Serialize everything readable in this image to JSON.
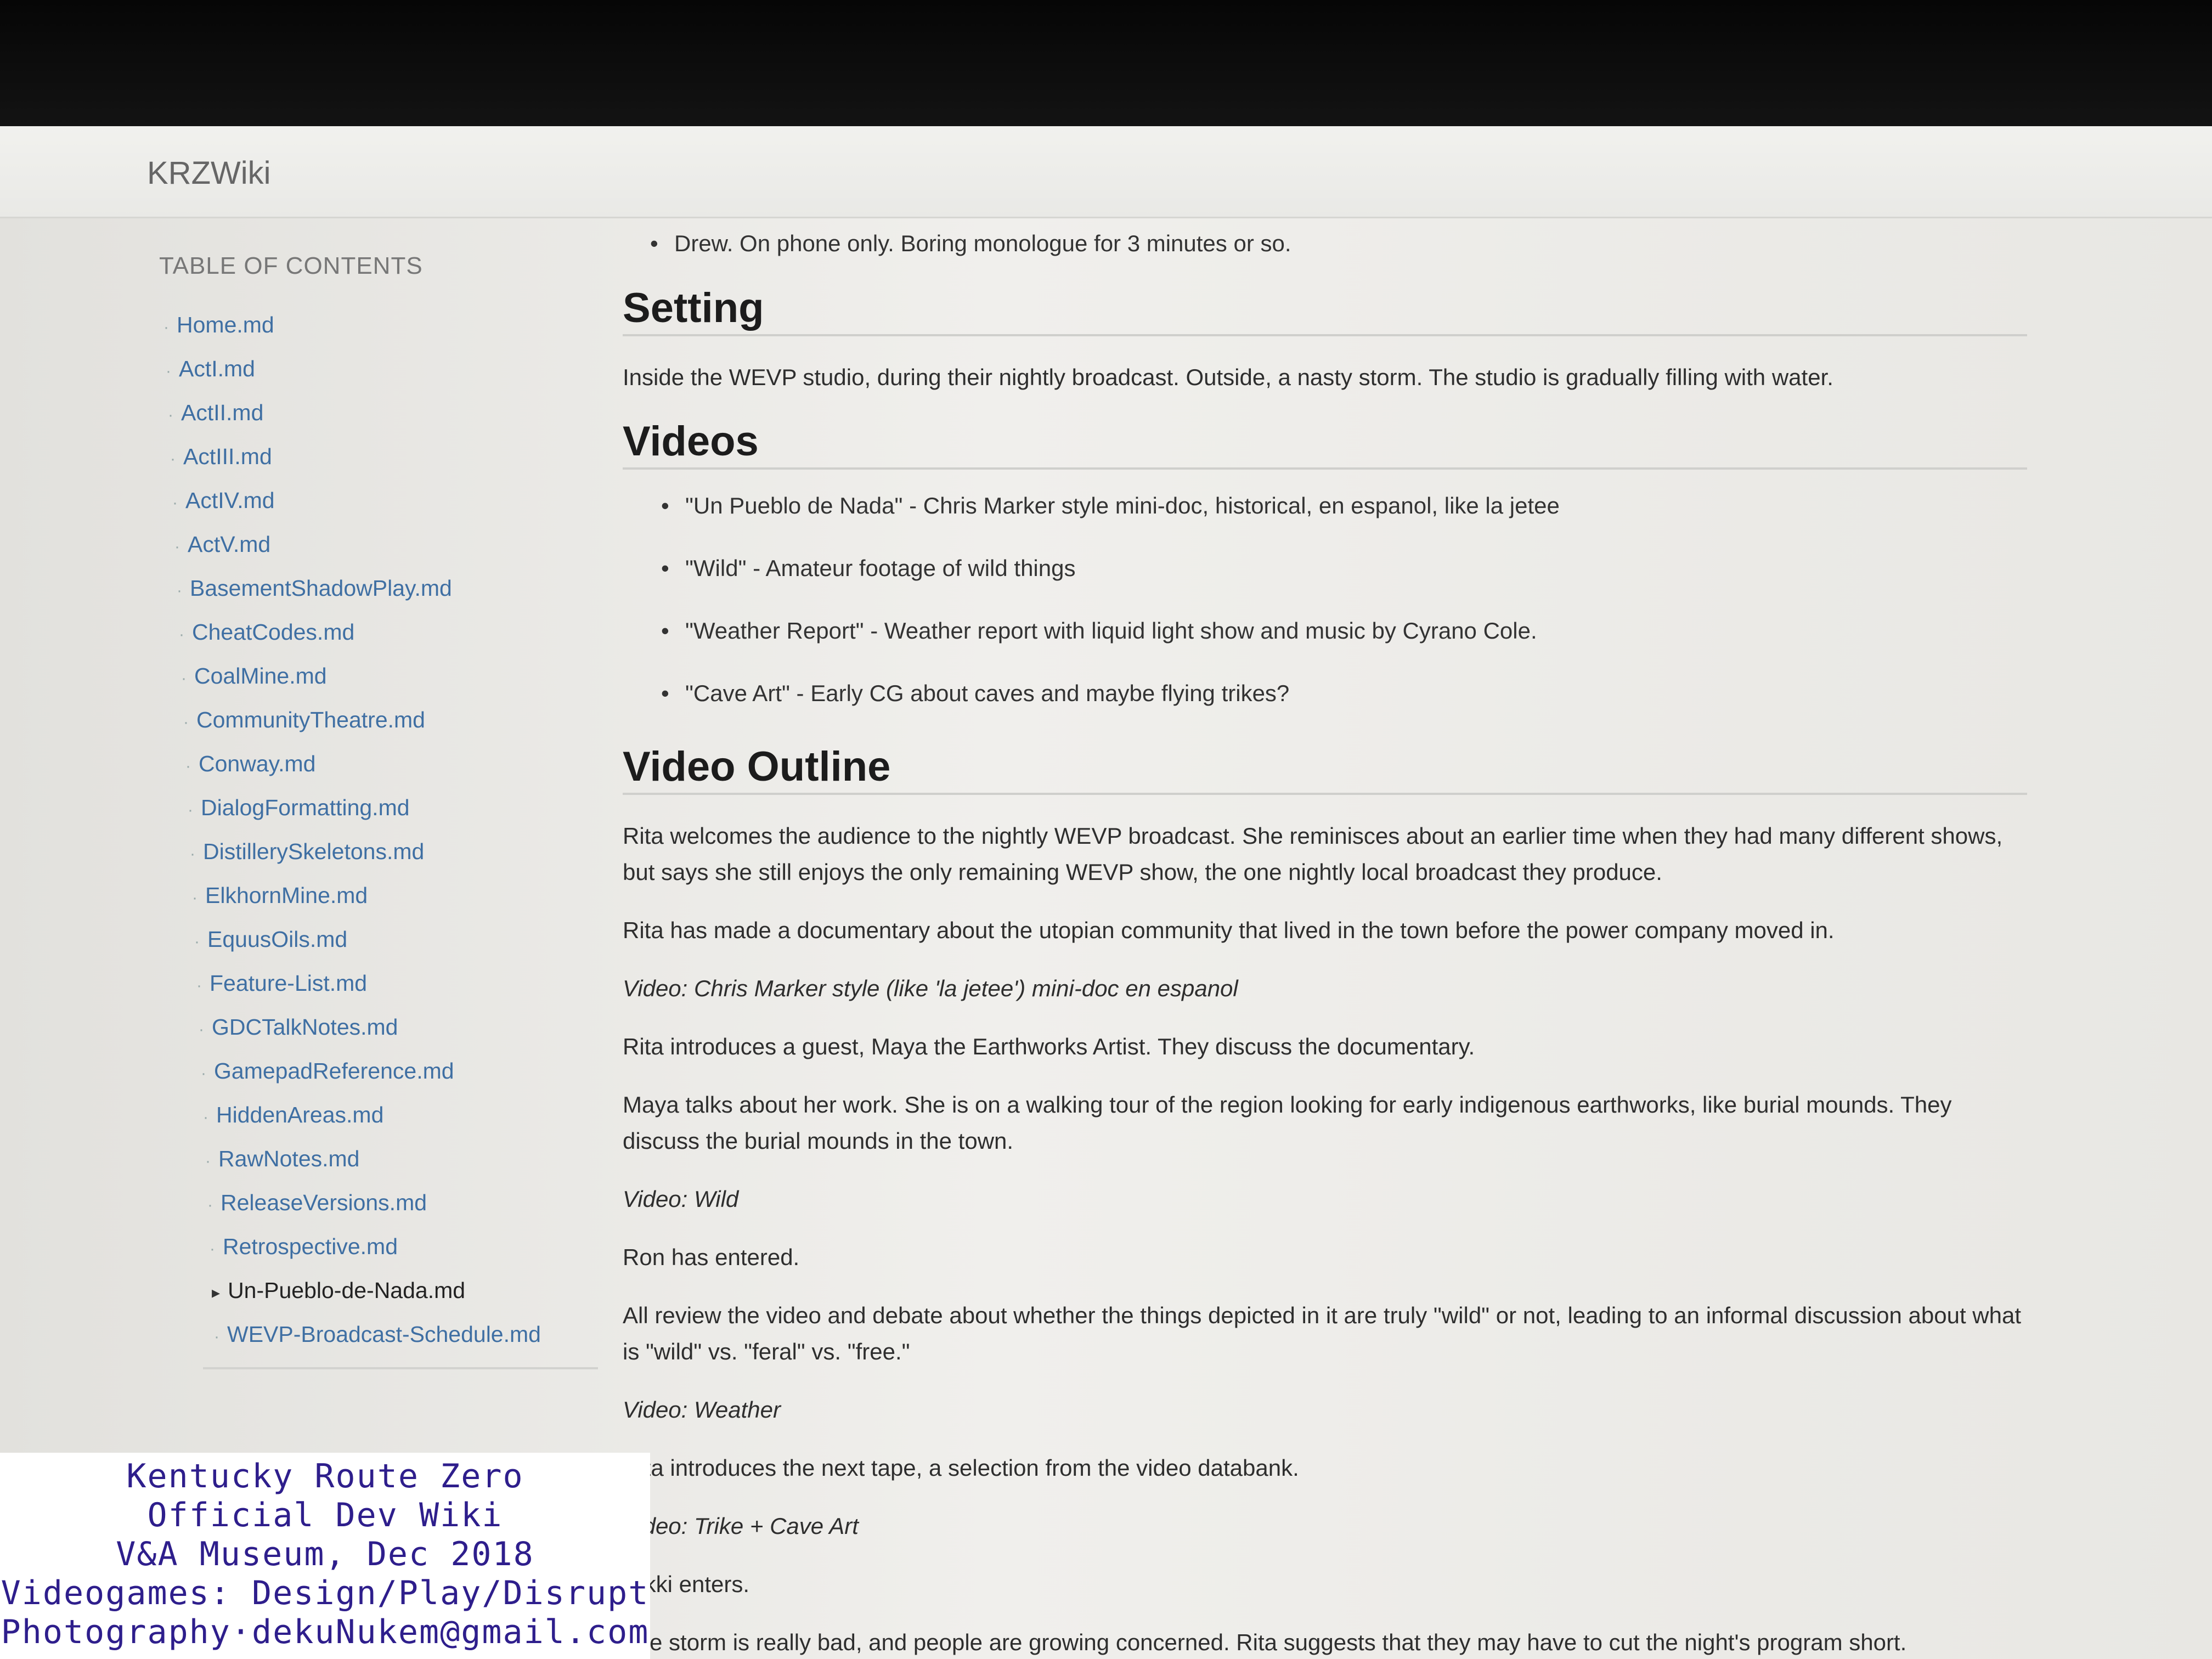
{
  "app": {
    "brand": "KRZWiki"
  },
  "sidebar": {
    "heading": "TABLE OF CONTENTS",
    "items": [
      {
        "label": "Home.md"
      },
      {
        "label": "ActI.md"
      },
      {
        "label": "ActII.md"
      },
      {
        "label": "ActIII.md"
      },
      {
        "label": "ActIV.md"
      },
      {
        "label": "ActV.md"
      },
      {
        "label": "BasementShadowPlay.md"
      },
      {
        "label": "CheatCodes.md"
      },
      {
        "label": "CoalMine.md"
      },
      {
        "label": "CommunityTheatre.md"
      },
      {
        "label": "Conway.md"
      },
      {
        "label": "DialogFormatting.md"
      },
      {
        "label": "DistillerySkeletons.md"
      },
      {
        "label": "ElkhornMine.md"
      },
      {
        "label": "EquusOils.md"
      },
      {
        "label": "Feature-List.md"
      },
      {
        "label": "GDCTalkNotes.md"
      },
      {
        "label": "GamepadReference.md"
      },
      {
        "label": "HiddenAreas.md"
      },
      {
        "label": "RawNotes.md"
      },
      {
        "label": "ReleaseVersions.md"
      },
      {
        "label": "Retrospective.md"
      },
      {
        "label": "Un-Pueblo-de-Nada.md",
        "active": true
      },
      {
        "label": "WEVP-Broadcast-Schedule.md"
      }
    ]
  },
  "content": {
    "top_bullet": "Drew. On phone only. Boring monologue for 3 minutes or so.",
    "setting_heading": "Setting",
    "setting_text": "Inside the WEVP studio, during their nightly broadcast. Outside, a nasty storm. The studio is gradually filling with water.",
    "videos_heading": "Videos",
    "videos": [
      "\"Un Pueblo de Nada\" - Chris Marker style mini-doc, historical, en espanol, like la jetee",
      "\"Wild\" - Amateur footage of wild things",
      "\"Weather Report\" - Weather report with liquid light show and music by Cyrano Cole.",
      "\"Cave Art\" - Early CG about caves and maybe flying trikes?"
    ],
    "outline_heading": "Video Outline",
    "outline": [
      {
        "text": "Rita welcomes the audience to the nightly WEVP broadcast. She reminisces about an earlier time when they had many different shows, but says she still enjoys the only remaining WEVP show, the one nightly local broadcast they produce.",
        "italic": false
      },
      {
        "text": "Rita has made a documentary about the utopian community that lived in the town before the power company moved in.",
        "italic": false
      },
      {
        "text": "Video: Chris Marker style (like 'la jetee') mini-doc en espanol",
        "italic": true
      },
      {
        "text": "Rita introduces a guest, Maya the Earthworks Artist. They discuss the documentary.",
        "italic": false
      },
      {
        "text": "Maya talks about her work. She is on a walking tour of the region looking for early indigenous earthworks, like burial mounds. They discuss the burial mounds in the town.",
        "italic": false
      },
      {
        "text": "Video: Wild",
        "italic": true
      },
      {
        "text": "Ron has entered.",
        "italic": false
      },
      {
        "text": "All review the video and debate about whether the things depicted in it are truly \"wild\" or not, leading to an informal discussion about what is \"wild\" vs. \"feral\" vs. \"free.\"",
        "italic": false
      },
      {
        "text": "Video: Weather",
        "italic": true
      },
      {
        "text": "Rita introduces the next tape, a selection from the video databank.",
        "italic": false
      },
      {
        "text": "Video: Trike + Cave Art",
        "italic": true
      },
      {
        "text": "Nikki enters.",
        "italic": false
      },
      {
        "text": "The storm is really bad, and people are growing concerned. Rita suggests that they may have to cut the night's program short.",
        "italic": false
      }
    ]
  },
  "watermark": {
    "lines": [
      "Kentucky Route Zero",
      "Official Dev Wiki",
      "V&A Museum, Dec 2018",
      "Videogames: Design/Play/Disrupt",
      "Photography·dekuNukem@gmail.com"
    ]
  }
}
